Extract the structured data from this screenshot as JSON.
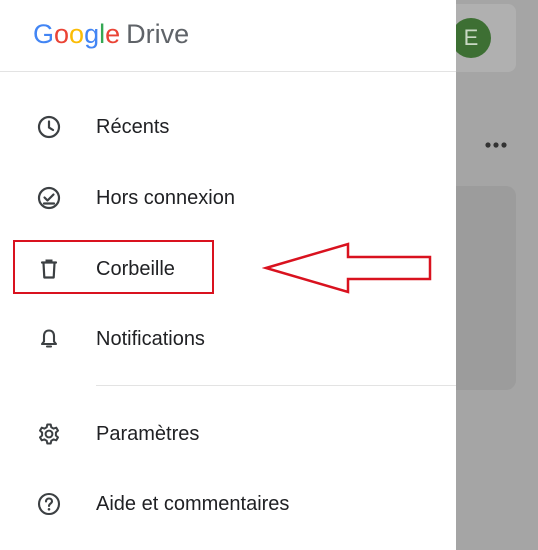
{
  "background": {
    "avatar_letter": "E",
    "more_icon": "more-horizontal-icon"
  },
  "drawer": {
    "logo_google": [
      "G",
      "o",
      "o",
      "g",
      "l",
      "e"
    ],
    "logo_drive": "Drive",
    "items": [
      {
        "label": "Récents",
        "icon": "clock-icon"
      },
      {
        "label": "Hors connexion",
        "icon": "offline-check-icon"
      },
      {
        "label": "Corbeille",
        "icon": "trash-icon"
      },
      {
        "label": "Notifications",
        "icon": "bell-icon"
      },
      {
        "label": "Paramètres",
        "icon": "gear-icon"
      },
      {
        "label": "Aide et commentaires",
        "icon": "help-icon"
      }
    ]
  },
  "annotation": {
    "color": "#d9121f",
    "highlighted_item": "Corbeille"
  },
  "colors": {
    "google_blue": "#4285f4",
    "google_red": "#ea4335",
    "google_yellow": "#fbbc05",
    "google_green": "#34a853",
    "avatar_green": "#3d6f33"
  }
}
